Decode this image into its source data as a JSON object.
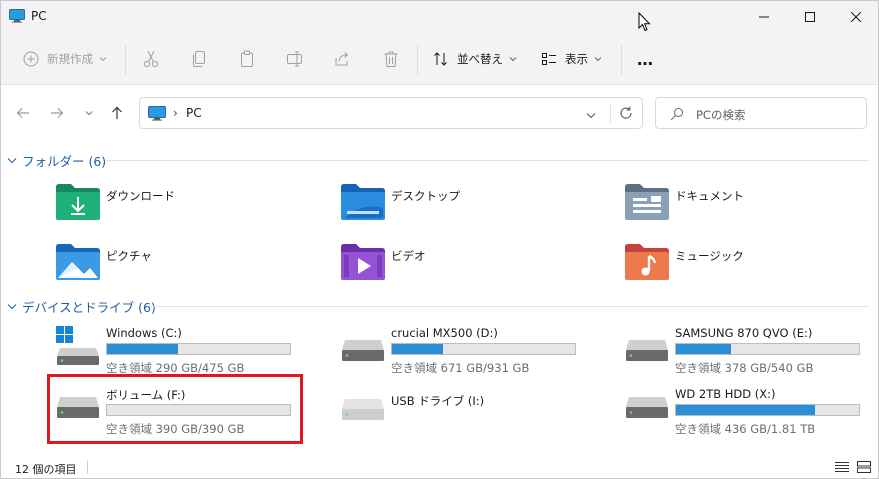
{
  "window": {
    "title": "PC"
  },
  "toolbar": {
    "new_label": "新規作成",
    "sort_label": "並べ替え",
    "view_label": "表示",
    "more_label": "…"
  },
  "address": {
    "path": "PC",
    "separator": "›"
  },
  "search": {
    "placeholder": "PCの検索"
  },
  "folders_section": {
    "title": "フォルダー (6)",
    "items": [
      {
        "name": "ダウンロード",
        "icon": "downloads-folder-icon"
      },
      {
        "name": "デスクトップ",
        "icon": "desktop-folder-icon"
      },
      {
        "name": "ドキュメント",
        "icon": "documents-folder-icon"
      },
      {
        "name": "ピクチャ",
        "icon": "pictures-folder-icon"
      },
      {
        "name": "ビデオ",
        "icon": "videos-folder-icon"
      },
      {
        "name": "ミュージック",
        "icon": "music-folder-icon"
      }
    ]
  },
  "drives_section": {
    "title": "デバイスとドライブ (6)",
    "items": [
      {
        "name": "Windows (C:)",
        "free": "空き領域 290 GB/475 GB",
        "used_fraction": 0.39,
        "icon": "windows-drive-icon"
      },
      {
        "name": "crucial MX500 (D:)",
        "free": "空き領域 671 GB/931 GB",
        "used_fraction": 0.28,
        "icon": "hard-drive-icon"
      },
      {
        "name": "SAMSUNG 870 QVO (E:)",
        "free": "空き領域 378 GB/540 GB",
        "used_fraction": 0.3,
        "icon": "hard-drive-icon"
      },
      {
        "name": "ボリューム (F:)",
        "free": "空き領域 390 GB/390 GB",
        "used_fraction": 0.0,
        "icon": "hard-drive-icon"
      },
      {
        "name": "USB ドライブ (I:)",
        "free": "",
        "used_fraction": null,
        "icon": "usb-drive-icon"
      },
      {
        "name": "WD 2TB HDD (X:)",
        "free": "空き領域 436 GB/1.81 TB",
        "used_fraction": 0.76,
        "icon": "hard-drive-icon"
      }
    ]
  },
  "status": {
    "item_count": "12 個の項目"
  },
  "colors": {
    "accent": "#2a8fd6",
    "section_header": "#1b5fa8",
    "highlight": "#e2161c"
  }
}
